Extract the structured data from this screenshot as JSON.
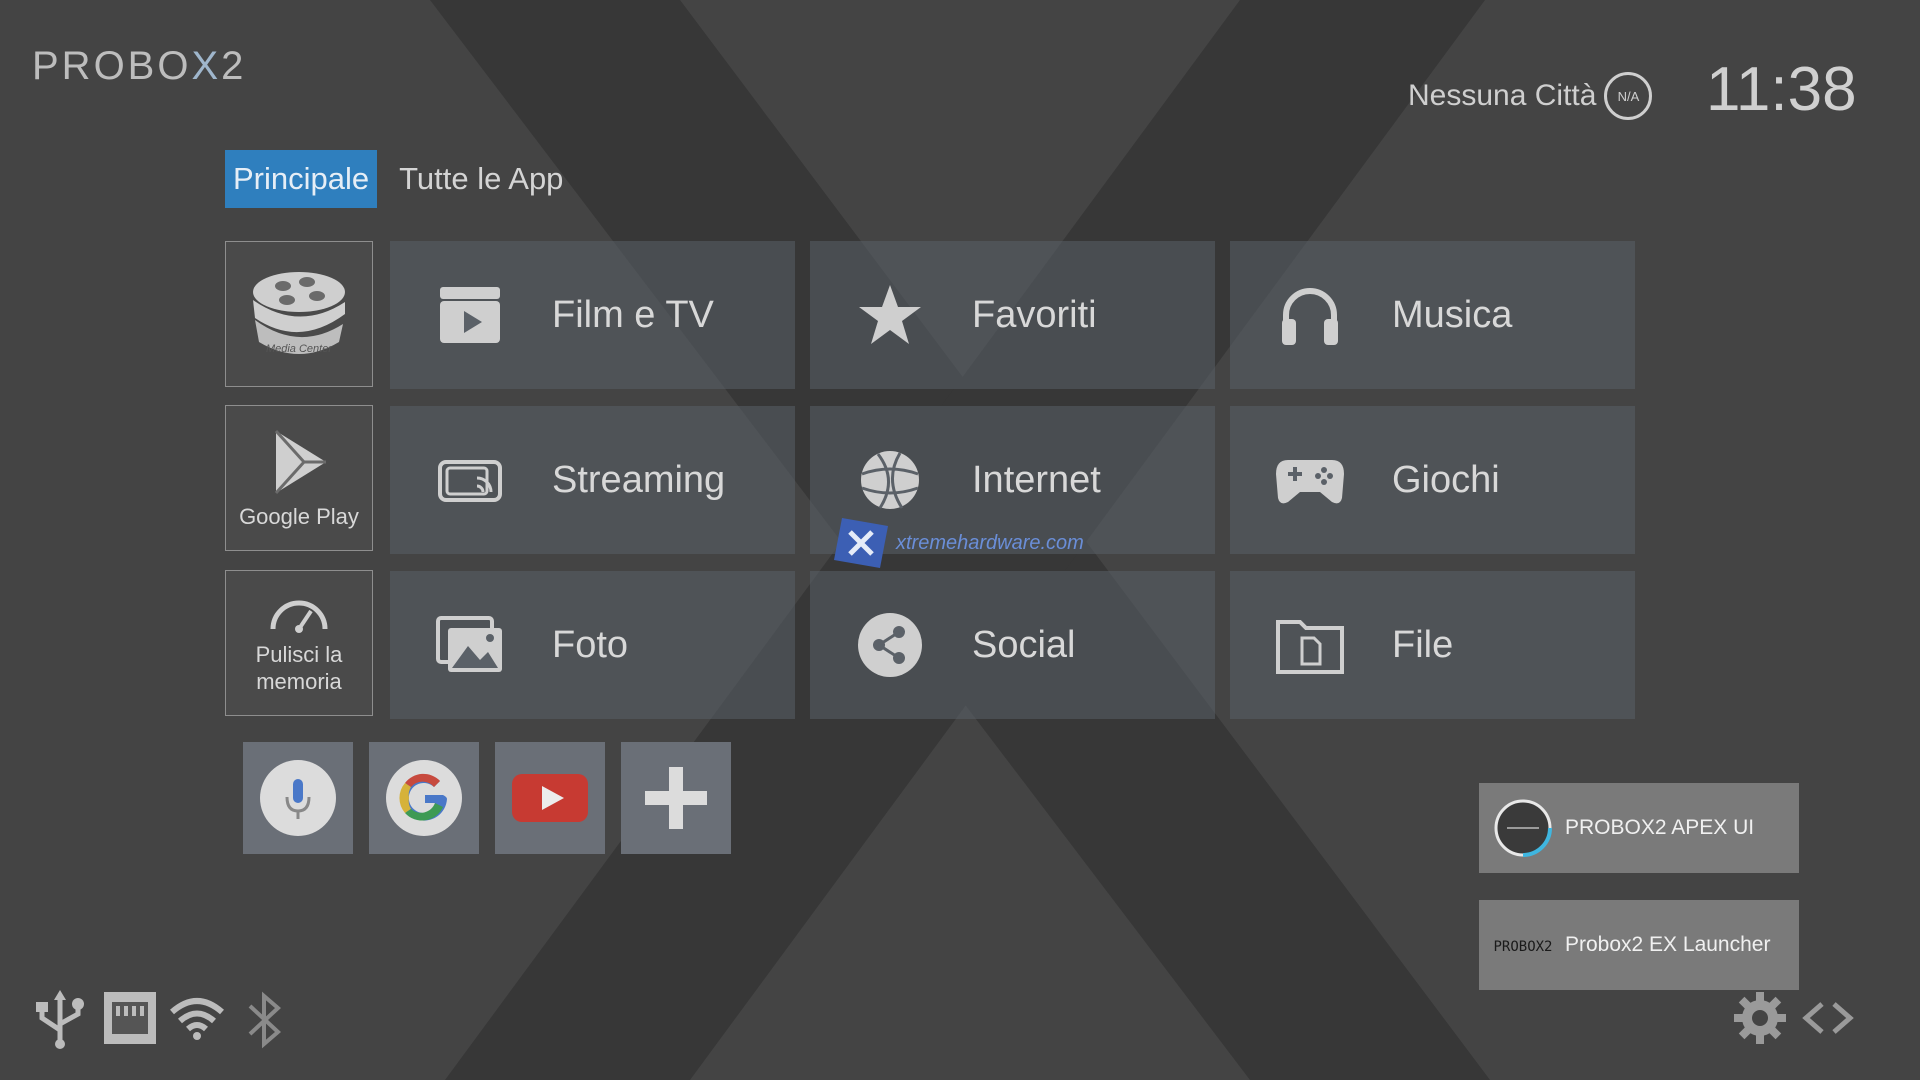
{
  "logo": {
    "pre": "PROBO",
    "x": "X",
    "post": "2"
  },
  "weather": {
    "city": "Nessuna Città",
    "badge": "N/A"
  },
  "clock": "11:38",
  "tabs": {
    "main": "Principale",
    "all_apps": "Tutte le App"
  },
  "shortcuts": {
    "media_center": "Media Center",
    "google_play": "Google Play",
    "clean_memory": "Pulisci la memoria"
  },
  "tiles": [
    {
      "label": "Film e TV",
      "icon": "film-icon"
    },
    {
      "label": "Favoriti",
      "icon": "star-icon"
    },
    {
      "label": "Musica",
      "icon": "headphones-icon"
    },
    {
      "label": "Streaming",
      "icon": "cast-icon"
    },
    {
      "label": "Internet",
      "icon": "globe-icon"
    },
    {
      "label": "Giochi",
      "icon": "gamepad-icon"
    },
    {
      "label": "Foto",
      "icon": "photos-icon"
    },
    {
      "label": "Social",
      "icon": "share-icon"
    },
    {
      "label": "File",
      "icon": "file-icon"
    }
  ],
  "quick_apps": [
    "microphone-icon",
    "google-icon",
    "youtube-icon",
    "plus-icon"
  ],
  "launchers": {
    "apex": "PROBOX2 APEX UI",
    "ex": "Probox2 EX Launcher",
    "ex_logo": "PROBOX2"
  },
  "watermark": "xtremehardware.com",
  "status_icons": [
    "usb-icon",
    "ethernet-icon",
    "wifi-icon",
    "bluetooth-icon"
  ],
  "colors": {
    "background": "#444444",
    "accent": "#2f7fbe",
    "tile": "#5a6168"
  }
}
